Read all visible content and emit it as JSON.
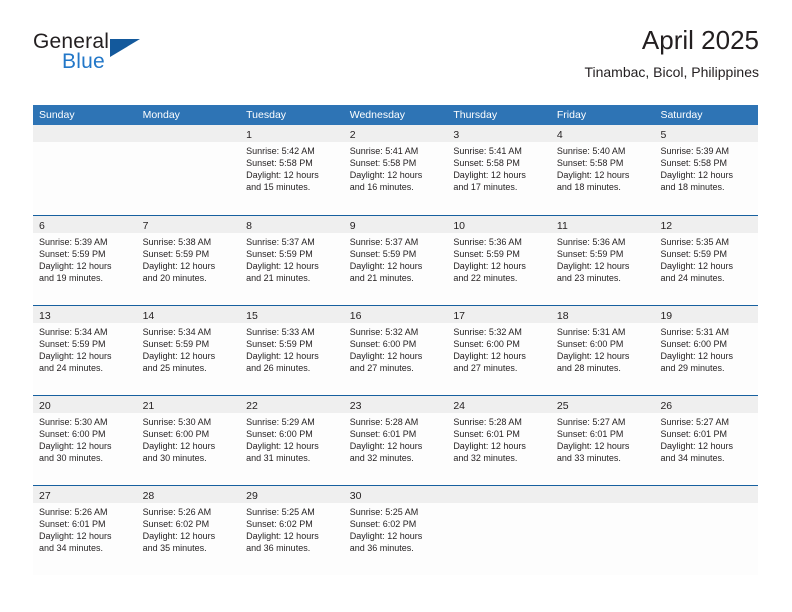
{
  "brand": {
    "name_part1": "General",
    "name_part2": "Blue",
    "flag_color": "#13599c",
    "blue_color": "#2277c8"
  },
  "header": {
    "title": "April 2025",
    "subtitle": "Tinambac, Bicol, Philippines"
  },
  "theme": {
    "header_band": "#2e74b5",
    "row_divider": "#17609f",
    "daynum_band": "#efefef",
    "text": "#231f20"
  },
  "weekdays": [
    "Sunday",
    "Monday",
    "Tuesday",
    "Wednesday",
    "Thursday",
    "Friday",
    "Saturday"
  ],
  "weeks": [
    [
      {
        "day": "",
        "lines": []
      },
      {
        "day": "",
        "lines": []
      },
      {
        "day": "1",
        "lines": [
          "Sunrise: 5:42 AM",
          "Sunset: 5:58 PM",
          "Daylight: 12 hours",
          "and 15 minutes."
        ]
      },
      {
        "day": "2",
        "lines": [
          "Sunrise: 5:41 AM",
          "Sunset: 5:58 PM",
          "Daylight: 12 hours",
          "and 16 minutes."
        ]
      },
      {
        "day": "3",
        "lines": [
          "Sunrise: 5:41 AM",
          "Sunset: 5:58 PM",
          "Daylight: 12 hours",
          "and 17 minutes."
        ]
      },
      {
        "day": "4",
        "lines": [
          "Sunrise: 5:40 AM",
          "Sunset: 5:58 PM",
          "Daylight: 12 hours",
          "and 18 minutes."
        ]
      },
      {
        "day": "5",
        "lines": [
          "Sunrise: 5:39 AM",
          "Sunset: 5:58 PM",
          "Daylight: 12 hours",
          "and 18 minutes."
        ]
      }
    ],
    [
      {
        "day": "6",
        "lines": [
          "Sunrise: 5:39 AM",
          "Sunset: 5:59 PM",
          "Daylight: 12 hours",
          "and 19 minutes."
        ]
      },
      {
        "day": "7",
        "lines": [
          "Sunrise: 5:38 AM",
          "Sunset: 5:59 PM",
          "Daylight: 12 hours",
          "and 20 minutes."
        ]
      },
      {
        "day": "8",
        "lines": [
          "Sunrise: 5:37 AM",
          "Sunset: 5:59 PM",
          "Daylight: 12 hours",
          "and 21 minutes."
        ]
      },
      {
        "day": "9",
        "lines": [
          "Sunrise: 5:37 AM",
          "Sunset: 5:59 PM",
          "Daylight: 12 hours",
          "and 21 minutes."
        ]
      },
      {
        "day": "10",
        "lines": [
          "Sunrise: 5:36 AM",
          "Sunset: 5:59 PM",
          "Daylight: 12 hours",
          "and 22 minutes."
        ]
      },
      {
        "day": "11",
        "lines": [
          "Sunrise: 5:36 AM",
          "Sunset: 5:59 PM",
          "Daylight: 12 hours",
          "and 23 minutes."
        ]
      },
      {
        "day": "12",
        "lines": [
          "Sunrise: 5:35 AM",
          "Sunset: 5:59 PM",
          "Daylight: 12 hours",
          "and 24 minutes."
        ]
      }
    ],
    [
      {
        "day": "13",
        "lines": [
          "Sunrise: 5:34 AM",
          "Sunset: 5:59 PM",
          "Daylight: 12 hours",
          "and 24 minutes."
        ]
      },
      {
        "day": "14",
        "lines": [
          "Sunrise: 5:34 AM",
          "Sunset: 5:59 PM",
          "Daylight: 12 hours",
          "and 25 minutes."
        ]
      },
      {
        "day": "15",
        "lines": [
          "Sunrise: 5:33 AM",
          "Sunset: 5:59 PM",
          "Daylight: 12 hours",
          "and 26 minutes."
        ]
      },
      {
        "day": "16",
        "lines": [
          "Sunrise: 5:32 AM",
          "Sunset: 6:00 PM",
          "Daylight: 12 hours",
          "and 27 minutes."
        ]
      },
      {
        "day": "17",
        "lines": [
          "Sunrise: 5:32 AM",
          "Sunset: 6:00 PM",
          "Daylight: 12 hours",
          "and 27 minutes."
        ]
      },
      {
        "day": "18",
        "lines": [
          "Sunrise: 5:31 AM",
          "Sunset: 6:00 PM",
          "Daylight: 12 hours",
          "and 28 minutes."
        ]
      },
      {
        "day": "19",
        "lines": [
          "Sunrise: 5:31 AM",
          "Sunset: 6:00 PM",
          "Daylight: 12 hours",
          "and 29 minutes."
        ]
      }
    ],
    [
      {
        "day": "20",
        "lines": [
          "Sunrise: 5:30 AM",
          "Sunset: 6:00 PM",
          "Daylight: 12 hours",
          "and 30 minutes."
        ]
      },
      {
        "day": "21",
        "lines": [
          "Sunrise: 5:30 AM",
          "Sunset: 6:00 PM",
          "Daylight: 12 hours",
          "and 30 minutes."
        ]
      },
      {
        "day": "22",
        "lines": [
          "Sunrise: 5:29 AM",
          "Sunset: 6:00 PM",
          "Daylight: 12 hours",
          "and 31 minutes."
        ]
      },
      {
        "day": "23",
        "lines": [
          "Sunrise: 5:28 AM",
          "Sunset: 6:01 PM",
          "Daylight: 12 hours",
          "and 32 minutes."
        ]
      },
      {
        "day": "24",
        "lines": [
          "Sunrise: 5:28 AM",
          "Sunset: 6:01 PM",
          "Daylight: 12 hours",
          "and 32 minutes."
        ]
      },
      {
        "day": "25",
        "lines": [
          "Sunrise: 5:27 AM",
          "Sunset: 6:01 PM",
          "Daylight: 12 hours",
          "and 33 minutes."
        ]
      },
      {
        "day": "26",
        "lines": [
          "Sunrise: 5:27 AM",
          "Sunset: 6:01 PM",
          "Daylight: 12 hours",
          "and 34 minutes."
        ]
      }
    ],
    [
      {
        "day": "27",
        "lines": [
          "Sunrise: 5:26 AM",
          "Sunset: 6:01 PM",
          "Daylight: 12 hours",
          "and 34 minutes."
        ]
      },
      {
        "day": "28",
        "lines": [
          "Sunrise: 5:26 AM",
          "Sunset: 6:02 PM",
          "Daylight: 12 hours",
          "and 35 minutes."
        ]
      },
      {
        "day": "29",
        "lines": [
          "Sunrise: 5:25 AM",
          "Sunset: 6:02 PM",
          "Daylight: 12 hours",
          "and 36 minutes."
        ]
      },
      {
        "day": "30",
        "lines": [
          "Sunrise: 5:25 AM",
          "Sunset: 6:02 PM",
          "Daylight: 12 hours",
          "and 36 minutes."
        ]
      },
      {
        "day": "",
        "lines": []
      },
      {
        "day": "",
        "lines": []
      },
      {
        "day": "",
        "lines": []
      }
    ]
  ]
}
